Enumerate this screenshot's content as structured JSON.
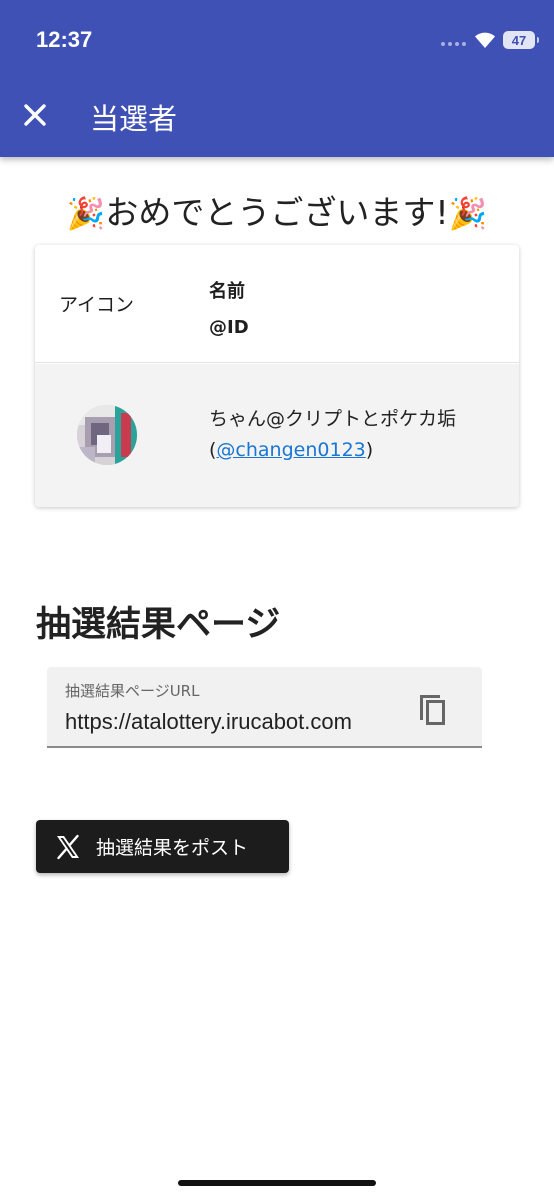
{
  "status_bar": {
    "time": "12:37",
    "battery": "47"
  },
  "app_bar": {
    "title": "当選者"
  },
  "headline": {
    "emoji_left": "🎉",
    "text": "おめでとうございます!",
    "emoji_right": "🎉"
  },
  "winner_table": {
    "header": {
      "icon": "アイコン",
      "name": "名前",
      "id": "@ID"
    },
    "row": {
      "name": "ちゃん@クリプトとポケカ垢",
      "id_prefix": "(",
      "id_link": "@changen0123",
      "id_suffix": ")"
    }
  },
  "result_section": {
    "title": "抽選結果ページ",
    "url_label": "抽選結果ページURL",
    "url_value": "https://atalottery.irucabot.com"
  },
  "post_button": {
    "label": "抽選結果をポスト"
  },
  "colors": {
    "app_bar": "#3f51b5",
    "link": "#1976d2",
    "post_button": "#1c1c1c"
  }
}
